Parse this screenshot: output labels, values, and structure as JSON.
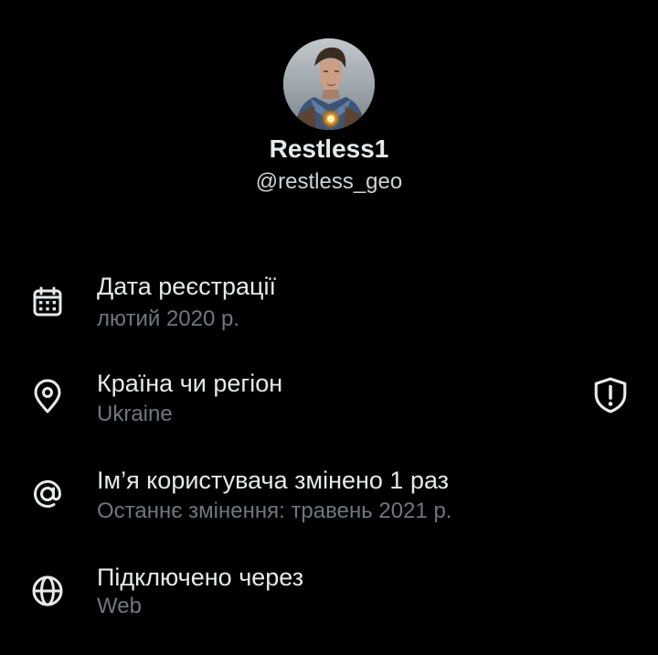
{
  "profile": {
    "display_name": "Restless1",
    "handle": "@restless_geo"
  },
  "rows": [
    {
      "icon": "calendar-icon",
      "title": "Дата реєстрації",
      "subtitle": "лютий 2020 р."
    },
    {
      "icon": "location-pin-icon",
      "title": "Країна чи регіон",
      "subtitle": "Ukraine",
      "trailing_icon": "shield-alert-icon"
    },
    {
      "icon": "at-sign-icon",
      "title": "Ім’я користувача змінено 1 раз",
      "subtitle": "Останнє змінення: травень 2021 р."
    },
    {
      "icon": "globe-icon",
      "title": "Підключено через",
      "subtitle": "Web"
    }
  ],
  "colors": {
    "background": "#000000",
    "primary_text": "#e7e9ea",
    "secondary_text": "#71767b"
  }
}
